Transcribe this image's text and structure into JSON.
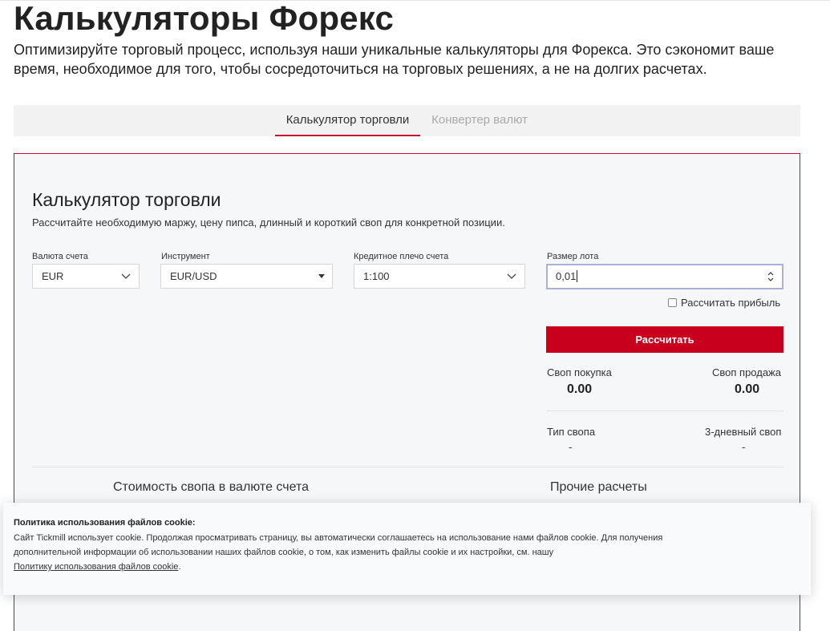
{
  "header": {
    "title": "Калькуляторы Форекс",
    "subtitle": "Оптимизируйте торговый процесс, используя наши уникальные калькуляторы для Форекса. Это сэкономит ваше время, необходимое для того, чтобы сосредоточиться на торговых решениях, а не на долгих расчетах."
  },
  "tabs": [
    {
      "label": "Калькулятор торговли",
      "active": true
    },
    {
      "label": "Конвертер валют",
      "active": false
    }
  ],
  "calculator": {
    "title": "Калькулятор торговли",
    "description": "Рассчитайте необходимую маржу, цену пипса, длинный и короткий своп для конкретной позиции.",
    "fields": {
      "account_currency": {
        "label": "Валюта счета",
        "value": "EUR"
      },
      "instrument": {
        "label": "Инструмент",
        "value": "EUR/USD"
      },
      "leverage": {
        "label": "Кредитное плечо счета",
        "value": "1:100"
      },
      "lot_size": {
        "label": "Размер лота",
        "value": "0,01"
      }
    },
    "profit_checkbox_label": "Рассчитать прибыль",
    "calculate_button": "Рассчитать",
    "results": {
      "swap_buy_label": "Своп покупка",
      "swap_buy_value": "0.00",
      "swap_sell_label": "Своп продажа",
      "swap_sell_value": "0.00",
      "swap_type_label": "Тип свопа",
      "swap_type_value": "-",
      "three_day_swap_label": "3-дневный своп",
      "three_day_swap_value": "-"
    },
    "sections": {
      "swap_cost": "Стоимость свопа в валюте счета",
      "other": "Прочие расчеты"
    }
  },
  "cookie_banner": {
    "title": "Политика использования файлов cookie:",
    "text": "Сайт Tickmill использует cookie. Продолжая просматривать страницу, вы автоматически соглашаетесь на использование нами файлов cookie. Для получения дополнительной информации об использовании наших файлов cookie, о том, как изменить файлы cookie и их настройки, см. нашу",
    "link": "Политику использования файлов cookie",
    "suffix": "."
  },
  "colors": {
    "accent": "#c8102e",
    "button": "#c8001e",
    "panel_bg": "#f6f7f9",
    "tabs_bg": "#f2f2f2"
  }
}
